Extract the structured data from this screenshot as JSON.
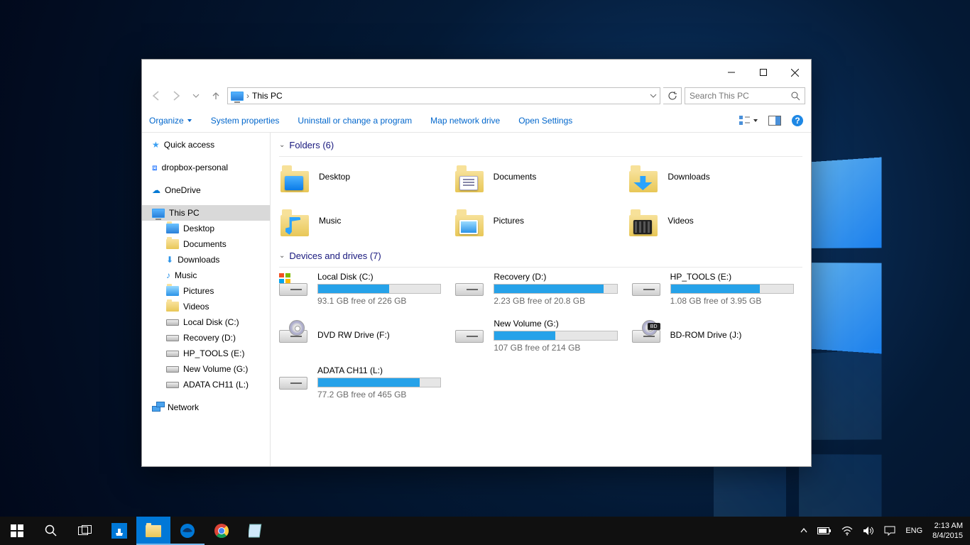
{
  "window": {
    "breadcrumb": "This PC",
    "search_placeholder": "Search This PC"
  },
  "cmdbar": {
    "organize": "Organize",
    "sysprops": "System properties",
    "uninstall": "Uninstall or change a program",
    "mapnet": "Map network drive",
    "opensettings": "Open Settings"
  },
  "nav": {
    "quick_access": "Quick access",
    "dropbox": "dropbox-personal",
    "onedrive": "OneDrive",
    "this_pc": "This PC",
    "desktop": "Desktop",
    "documents": "Documents",
    "downloads": "Downloads",
    "music": "Music",
    "pictures": "Pictures",
    "videos": "Videos",
    "local_c": "Local Disk (C:)",
    "recovery_d": "Recovery (D:)",
    "hptools_e": "HP_TOOLS (E:)",
    "newvol_g": "New Volume (G:)",
    "adata_l": "ADATA CH11 (L:)",
    "network": "Network"
  },
  "groups": {
    "folders_header": "Folders (6)",
    "drives_header": "Devices and drives (7)"
  },
  "folders": {
    "desktop": "Desktop",
    "documents": "Documents",
    "downloads": "Downloads",
    "music": "Music",
    "pictures": "Pictures",
    "videos": "Videos"
  },
  "drives": {
    "c": {
      "name": "Local Disk (C:)",
      "free": "93.1 GB free of 226 GB",
      "pct": 58
    },
    "d": {
      "name": "Recovery (D:)",
      "free": "2.23 GB free of 20.8 GB",
      "pct": 89
    },
    "e": {
      "name": "HP_TOOLS (E:)",
      "free": "1.08 GB free of 3.95 GB",
      "pct": 73
    },
    "f": {
      "name": "DVD RW Drive (F:)"
    },
    "g": {
      "name": "New Volume (G:)",
      "free": "107 GB free of 214 GB",
      "pct": 50
    },
    "j": {
      "name": "BD-ROM Drive (J:)"
    },
    "l": {
      "name": "ADATA CH11 (L:)",
      "free": "77.2 GB free of 465 GB",
      "pct": 83
    }
  },
  "tray": {
    "lang": "ENG",
    "time": "2:13 AM",
    "date": "8/4/2015"
  }
}
